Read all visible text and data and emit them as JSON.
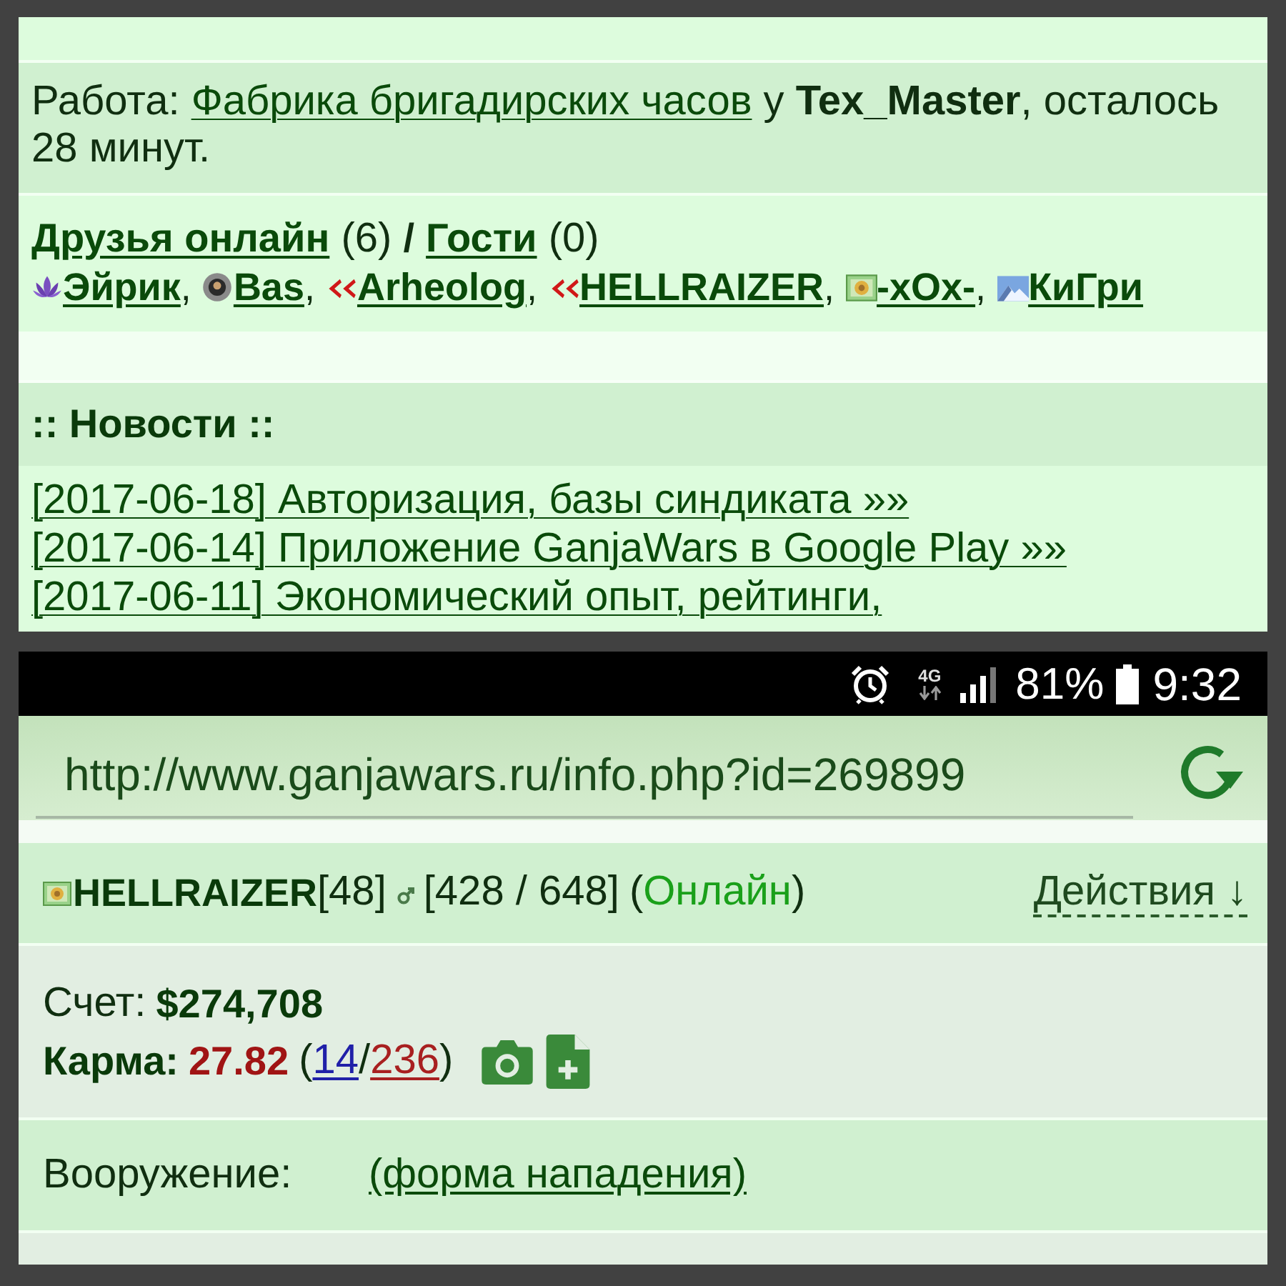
{
  "top_screenshot": {
    "work": {
      "label": "Работа:",
      "link": "Фабрика бригадирских часов",
      "rest": "у **Tex_Master**, осталось 28 минут."
    },
    "friends": {
      "friends_link": "Друзья онлайн",
      "friends_count": "(6)",
      "divider": "/",
      "guests_link": "Гости",
      "guests_count": "(0)",
      "separator": ",",
      "items": [
        {
          "name": "Эйрик",
          "kind": "lotus"
        },
        {
          "name": "Bas",
          "kind": "disc"
        },
        {
          "name": "Arheolog",
          "kind": "chevrons"
        },
        {
          "name": "HELLRAIZER",
          "kind": "chevrons"
        },
        {
          "name": "-xOx-",
          "kind": "framed"
        },
        {
          "name": "КиГри",
          "kind": "landscape"
        }
      ]
    },
    "news": {
      "title": ":: Новости ::",
      "items": [
        "[2017-06-18] Авторизация, базы синдиката »»",
        "[2017-06-14] Приложение GanjaWars в Google Play »»",
        "[2017-06-11] Экономический опыт, рейтинги,"
      ]
    }
  },
  "bottom_screenshot": {
    "status_bar": {
      "network": "4G",
      "battery_percent": "81%",
      "time": "9:32"
    },
    "address_bar": {
      "url": "http://www.ganjawars.ru/info.php?id=269899"
    },
    "profile": {
      "avatar": {
        "kind": "framed"
      },
      "name": "HELLRAIZER",
      "rank": "[48]",
      "hp": "[428 / 648]",
      "status": {
        "open": "(",
        "label": "Онлайн",
        "close": ")",
        "online": true
      },
      "actions": "Действия ↓"
    },
    "account": {
      "balance_label": "Счет:",
      "balance": "$274,708",
      "karma_label": "Карма:",
      "karma": "27.82",
      "votes": {
        "open": "(",
        "positive": "14",
        "slash": "/",
        "negative": "236",
        "close": ")"
      }
    },
    "armament": {
      "label": "Вооружение:",
      "link": "(форма нападения)"
    }
  }
}
